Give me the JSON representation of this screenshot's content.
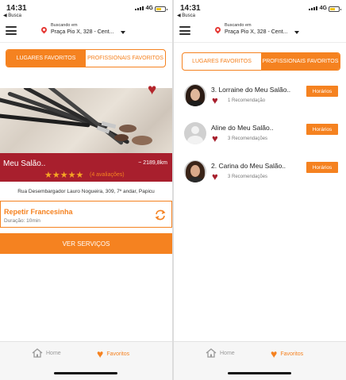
{
  "status": {
    "time": "14:31",
    "network": "4G",
    "back_label": "◀ Busca"
  },
  "header": {
    "searching_label": "Buscando em",
    "location": "Praça Pio X, 328 - Cent..."
  },
  "tabs": {
    "places": "LUGARES FAVORITOS",
    "professionals": "PROFISSIONAIS FAVORITOS"
  },
  "screen1": {
    "active_tab": "places",
    "salon": {
      "name": "Meu Salão..",
      "distance": "~ 2189,8km",
      "rating": 5,
      "stars": "★★★★★",
      "ratings_count": "(4 avaliações)",
      "address": "Rua Desembargador Lauro Nogueira, 309, 7º andar, Papicu",
      "favorite": true
    },
    "last_service": {
      "name": "Repetir Francesinha",
      "duration": "Duração: 10min"
    },
    "cta": "VER SERVIÇOS"
  },
  "screen2": {
    "active_tab": "professionals",
    "professionals": [
      {
        "name": "3. Lorraine do Meu Salão..",
        "recommendations": "1 Recomendação",
        "button": "Horários",
        "avatar": "photo"
      },
      {
        "name": "Aline do Meu Salão..",
        "recommendations": "3 Recomendações",
        "button": "Horários",
        "avatar": "generic"
      },
      {
        "name": "2. Carina do Meu Salão..",
        "recommendations": "3 Recomendações",
        "button": "Horários",
        "avatar": "photo"
      }
    ]
  },
  "nav": {
    "home": "Home",
    "favorites": "Favoritos",
    "active": "favorites"
  },
  "colors": {
    "accent": "#f58220",
    "salon_bar": "#a81f2d",
    "heart": "#b3262c"
  },
  "icons": [
    "menu-icon",
    "location-pin-icon",
    "heart-icon",
    "star-icon",
    "repeat-icon",
    "home-icon"
  ]
}
